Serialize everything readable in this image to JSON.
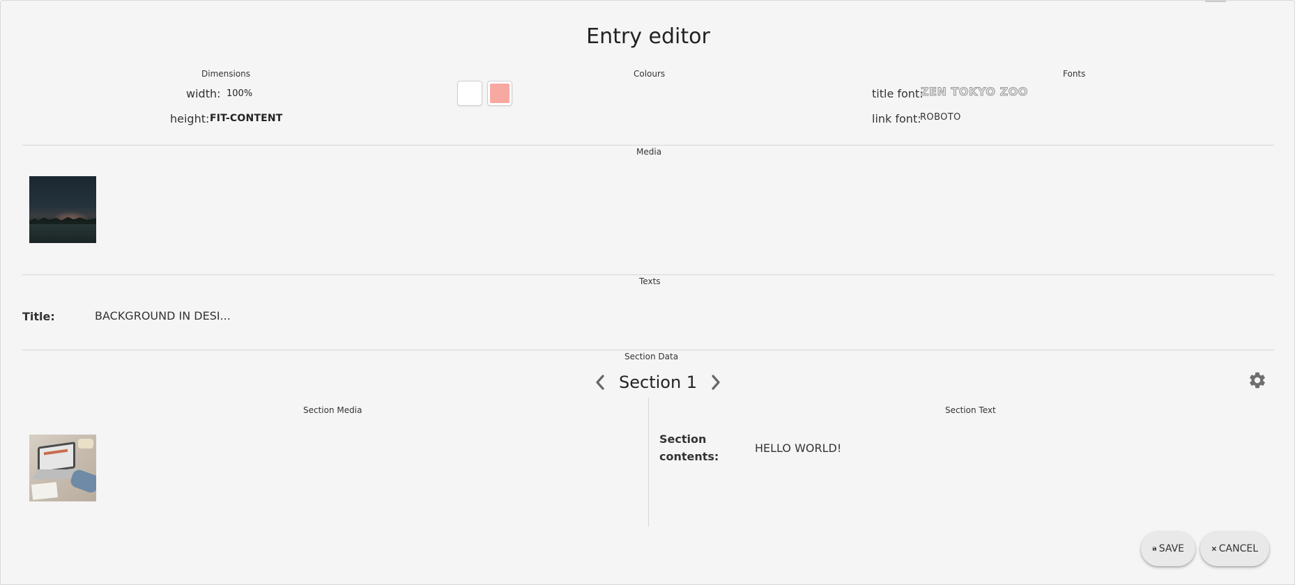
{
  "dialog": {
    "title": "Entry editor"
  },
  "dimensions": {
    "heading": "Dimensions",
    "width_label": "width:",
    "width_value": "100%",
    "height_label": "height:",
    "height_value": "FIT-CONTENT"
  },
  "colours": {
    "heading": "Colours",
    "swatches": [
      "#ffffff",
      "#f7a9a1"
    ]
  },
  "fonts": {
    "heading": "Fonts",
    "title_font_label": "title font:",
    "title_font_value": "ZEN TOKYO ZOO",
    "link_font_label": "link font:",
    "link_font_value": "ROBOTO"
  },
  "media": {
    "heading": "Media",
    "thumbnail_icon": "night-landscape-image"
  },
  "texts": {
    "heading": "Texts",
    "title_label": "Title:",
    "title_value": "BACKGROUND IN DESI..."
  },
  "section_data": {
    "heading": "Section Data",
    "current_section": "Section 1",
    "prev_icon": "chevron-left-icon",
    "next_icon": "chevron-right-icon",
    "settings_icon": "gear-icon",
    "media_heading": "Section Media",
    "media_thumbnail_icon": "laptop-desk-image",
    "text_heading": "Section Text",
    "contents_label_line1": "Section",
    "contents_label_line2": "contents:",
    "contents_value": "HELLO WORLD!"
  },
  "actions": {
    "save_label": "SAVE",
    "save_icon": "floppy-disk-icon",
    "cancel_label": "CANCEL",
    "cancel_icon": "close-icon"
  }
}
